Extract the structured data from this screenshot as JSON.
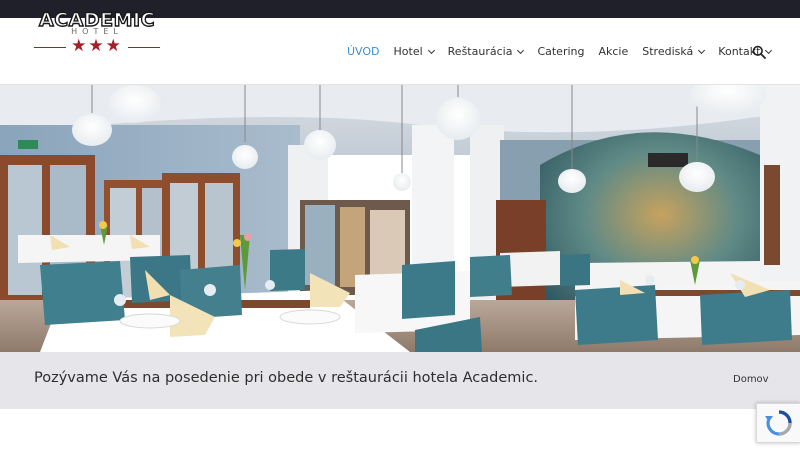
{
  "logo": {
    "wordmark": "ACADEMIC",
    "subtitle": "HOTEL",
    "stars": "★★★",
    "accent_color": "#a3202a"
  },
  "nav": {
    "items": [
      {
        "label": "ÚVOD",
        "active": true,
        "has_dropdown": false
      },
      {
        "label": "Hotel",
        "active": false,
        "has_dropdown": true
      },
      {
        "label": "Reštaurácia",
        "active": false,
        "has_dropdown": true
      },
      {
        "label": "Catering",
        "active": false,
        "has_dropdown": false
      },
      {
        "label": "Akcie",
        "active": false,
        "has_dropdown": false
      },
      {
        "label": "Strediská",
        "active": false,
        "has_dropdown": true
      },
      {
        "label": "Kontakt",
        "active": false,
        "has_dropdown": true
      }
    ],
    "active_color": "#3a8fd6",
    "search_icon": "search-icon"
  },
  "hero": {
    "image": "restaurant-interior-photo"
  },
  "page": {
    "caption": "Pozývame Vás na posedenie pri obede v reštaurácii hotela Academic.",
    "breadcrumb": "Domov"
  },
  "recaptcha": {
    "icon": "recaptcha-icon"
  }
}
